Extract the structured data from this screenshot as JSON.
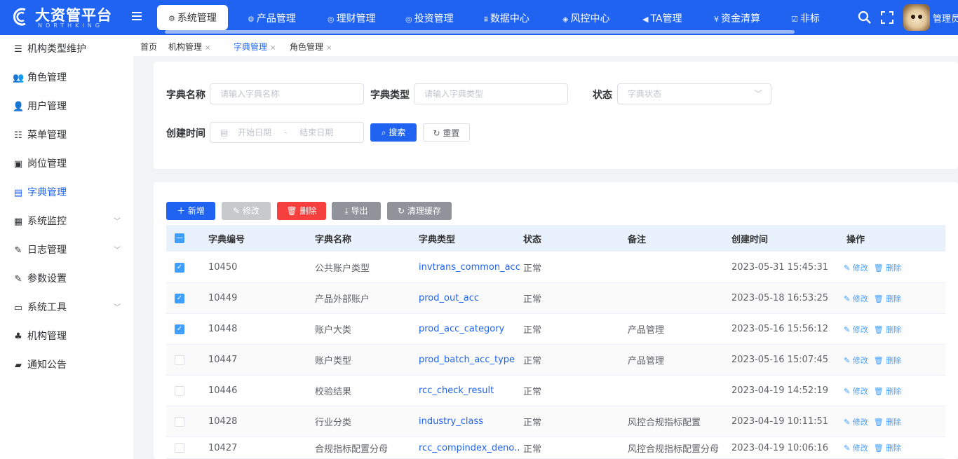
{
  "app": {
    "title": "大资管平台",
    "subtitle": "NORTHKING"
  },
  "top_nav": [
    {
      "label": "系统管理",
      "icon": "⚙"
    },
    {
      "label": "产品管理",
      "icon": "⚙"
    },
    {
      "label": "理财管理",
      "icon": "◎"
    },
    {
      "label": "投资管理",
      "icon": "◎"
    },
    {
      "label": "数据中心",
      "icon": "⩩"
    },
    {
      "label": "风控中心",
      "icon": "◈"
    },
    {
      "label": "TA管理",
      "icon": "◀"
    },
    {
      "label": "资金清算",
      "icon": "¥"
    },
    {
      "label": "非标",
      "icon": "☑"
    }
  ],
  "user": {
    "name": "管理员"
  },
  "sidebar": [
    {
      "label": "机构类型维护",
      "icon": "☰"
    },
    {
      "label": "角色管理",
      "icon": "👥"
    },
    {
      "label": "用户管理",
      "icon": "👤"
    },
    {
      "label": "菜单管理",
      "icon": "☷"
    },
    {
      "label": "岗位管理",
      "icon": "▣"
    },
    {
      "label": "字典管理",
      "icon": "▤"
    },
    {
      "label": "系统监控",
      "icon": "▦",
      "arrow": "﹀"
    },
    {
      "label": "日志管理",
      "icon": "✎",
      "arrow": "﹀"
    },
    {
      "label": "参数设置",
      "icon": "✎"
    },
    {
      "label": "系统工具",
      "icon": "▭",
      "arrow": "﹀"
    },
    {
      "label": "机构管理",
      "icon": "♣"
    },
    {
      "label": "通知公告",
      "icon": "▰"
    }
  ],
  "tags": [
    {
      "label": "首页",
      "close": ""
    },
    {
      "label": "机构管理",
      "close": "×"
    },
    {
      "label": "字典管理",
      "close": "×"
    },
    {
      "label": "角色管理",
      "close": "×"
    }
  ],
  "search": {
    "dict_name_label": "字典名称",
    "dict_name_placeholder": "请输入字典名称",
    "dict_type_label": "字典类型",
    "dict_type_placeholder": "请输入字典类型",
    "status_label": "状态",
    "status_placeholder": "字典状态",
    "created_label": "创建时间",
    "start_placeholder": "开始日期",
    "range_sep": "-",
    "end_placeholder": "结束日期",
    "search_btn": "搜索",
    "reset_btn": "重置"
  },
  "toolbar": {
    "add": "新增",
    "edit": "修改",
    "delete": "删除",
    "export": "导出",
    "clear_cache": "清理缓存"
  },
  "table": {
    "headers": [
      "字典编号",
      "字典名称",
      "字典类型",
      "状态",
      "备注",
      "创建时间",
      "操作"
    ],
    "edit_label": "修改",
    "delete_label": "删除",
    "rows": [
      {
        "id": "10450",
        "name": "公共账户类型",
        "type": "invtrans_common_acct",
        "status": "正常",
        "remark": "",
        "created": "2023-05-31 15:45:31",
        "checked": true
      },
      {
        "id": "10449",
        "name": "产品外部账户",
        "type": "prod_out_acc",
        "status": "正常",
        "remark": "",
        "created": "2023-05-18 16:53:25",
        "checked": true
      },
      {
        "id": "10448",
        "name": "账户大类",
        "type": "prod_acc_category",
        "status": "正常",
        "remark": "产品管理",
        "created": "2023-05-16 15:56:12",
        "checked": true
      },
      {
        "id": "10447",
        "name": "账户类型",
        "type": "prod_batch_acc_type",
        "status": "正常",
        "remark": "产品管理",
        "created": "2023-05-16 15:07:45",
        "checked": false
      },
      {
        "id": "10446",
        "name": "校验结果",
        "type": "rcc_check_result",
        "status": "正常",
        "remark": "",
        "created": "2023-04-19 14:52:19",
        "checked": false
      },
      {
        "id": "10428",
        "name": "行业分类",
        "type": "industry_class",
        "status": "正常",
        "remark": "风控合规指标配置",
        "created": "2023-04-19 10:11:51",
        "checked": false
      },
      {
        "id": "10427",
        "name": "合规指标配置分母",
        "type": "rcc_compindex_deno...",
        "status": "正常",
        "remark": "风控合规指标配置分母",
        "created": "2023-04-19 10:06:16",
        "checked": false
      }
    ]
  },
  "colors": {
    "primary": "#1f63f0",
    "danger": "#f5403d",
    "disabled": "#c8c9cc",
    "info": "#909399"
  }
}
